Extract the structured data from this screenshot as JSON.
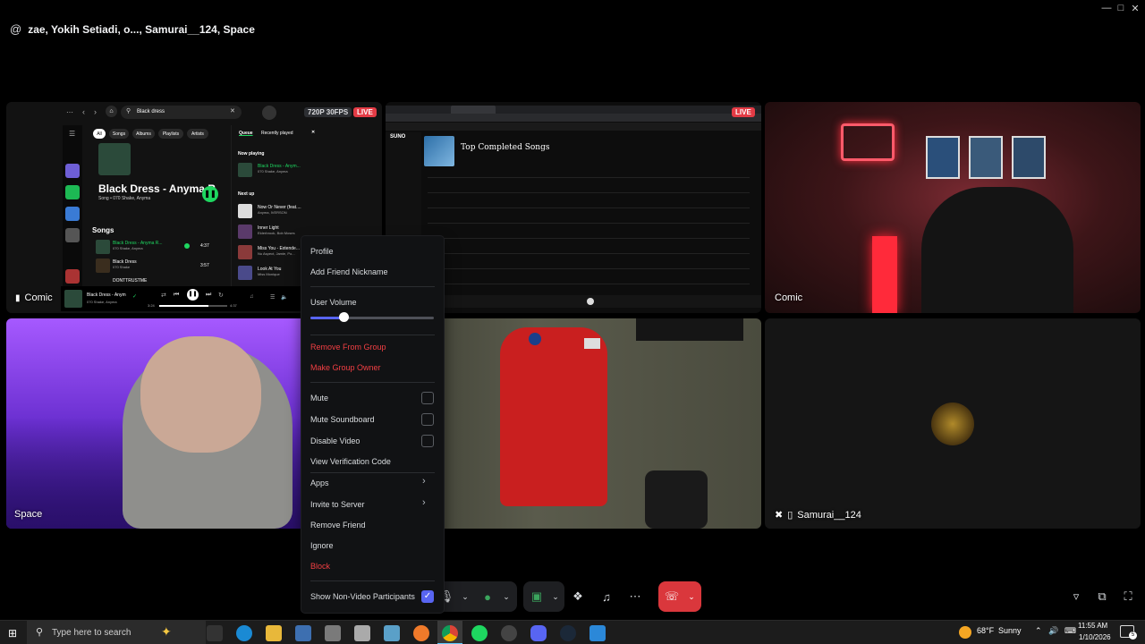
{
  "window": {
    "title": "zae, Yokih Setiadi, o..., Samurai__124, Space",
    "at_symbol": "@"
  },
  "tiles": {
    "comic_screen": {
      "label": "Comic",
      "badge_res": "720P 30FPS",
      "badge_live": "LIVE"
    },
    "suno_screen": {
      "badge_live": "LIVE"
    },
    "comic_cam": {
      "label": "Comic"
    },
    "space_cam": {
      "label": "Space"
    },
    "samurai": {
      "label": "Samurai__124"
    }
  },
  "spotify": {
    "search_value": "Black dress",
    "chips": [
      "All",
      "Songs",
      "Albums",
      "Playlists",
      "Artists"
    ],
    "hero_title": "Black Dress - Anyma R",
    "hero_sub": "Song • 070 Shake, Anyma",
    "songs_heading": "Songs",
    "songs": [
      {
        "title": "Black Dress - Anyma R...",
        "artist": "070 Shake, Anyma",
        "time": "4:37"
      },
      {
        "title": "Black Dress",
        "artist": "070 Shake",
        "time": "3:57"
      },
      {
        "title": "DONTTRUSTME",
        "artist": "",
        "time": ""
      }
    ],
    "queue_tabs": [
      "Queue",
      "Recently played"
    ],
    "now_playing_heading": "Now playing",
    "now_playing": {
      "title": "Black Dress - Anym...",
      "artist": "070 Shake, Anyma"
    },
    "next_up_heading": "Next up",
    "next_up": [
      {
        "title": "Now Or Never (feat....",
        "artist": "Anyma, IVERSON"
      },
      {
        "title": "Inner Light",
        "artist": "Elderbrook, Bob Moses"
      },
      {
        "title": "Miss You - Extende...",
        "artist": "Nu Aspect, Jamie, Po..."
      },
      {
        "title": "Look At You",
        "artist": "Miss Monique"
      }
    ],
    "player": {
      "title": "Black Dress - Anym",
      "artist": "070 Shake, Anyma",
      "elapsed": "3:24",
      "total": "4:37"
    }
  },
  "suno": {
    "logo": "SUNO",
    "playlist_title": "Top Completed Songs"
  },
  "context_menu": {
    "profile": "Profile",
    "add_nickname": "Add Friend Nickname",
    "user_volume": "User Volume",
    "volume_level": 0.27,
    "remove_from_group": "Remove From Group",
    "make_group_owner": "Make Group Owner",
    "mute": "Mute",
    "mute_soundboard": "Mute Soundboard",
    "disable_video": "Disable Video",
    "view_verification": "View Verification Code",
    "apps": "Apps",
    "invite_to_server": "Invite to Server",
    "remove_friend": "Remove Friend",
    "ignore": "Ignore",
    "block": "Block",
    "show_non_video": "Show Non-Video Participants",
    "show_non_video_checked": true
  },
  "taskbar": {
    "search_placeholder": "Type here to search",
    "weather_temp": "68°F",
    "weather_desc": "Sunny",
    "time": "11:55 AM",
    "date": "1/10/2026",
    "notification_count": "5"
  },
  "colors": {
    "discord_blurple": "#5865f2",
    "danger": "#f23f43",
    "spotify_green": "#1ed760",
    "live_red": "#e33b45"
  }
}
